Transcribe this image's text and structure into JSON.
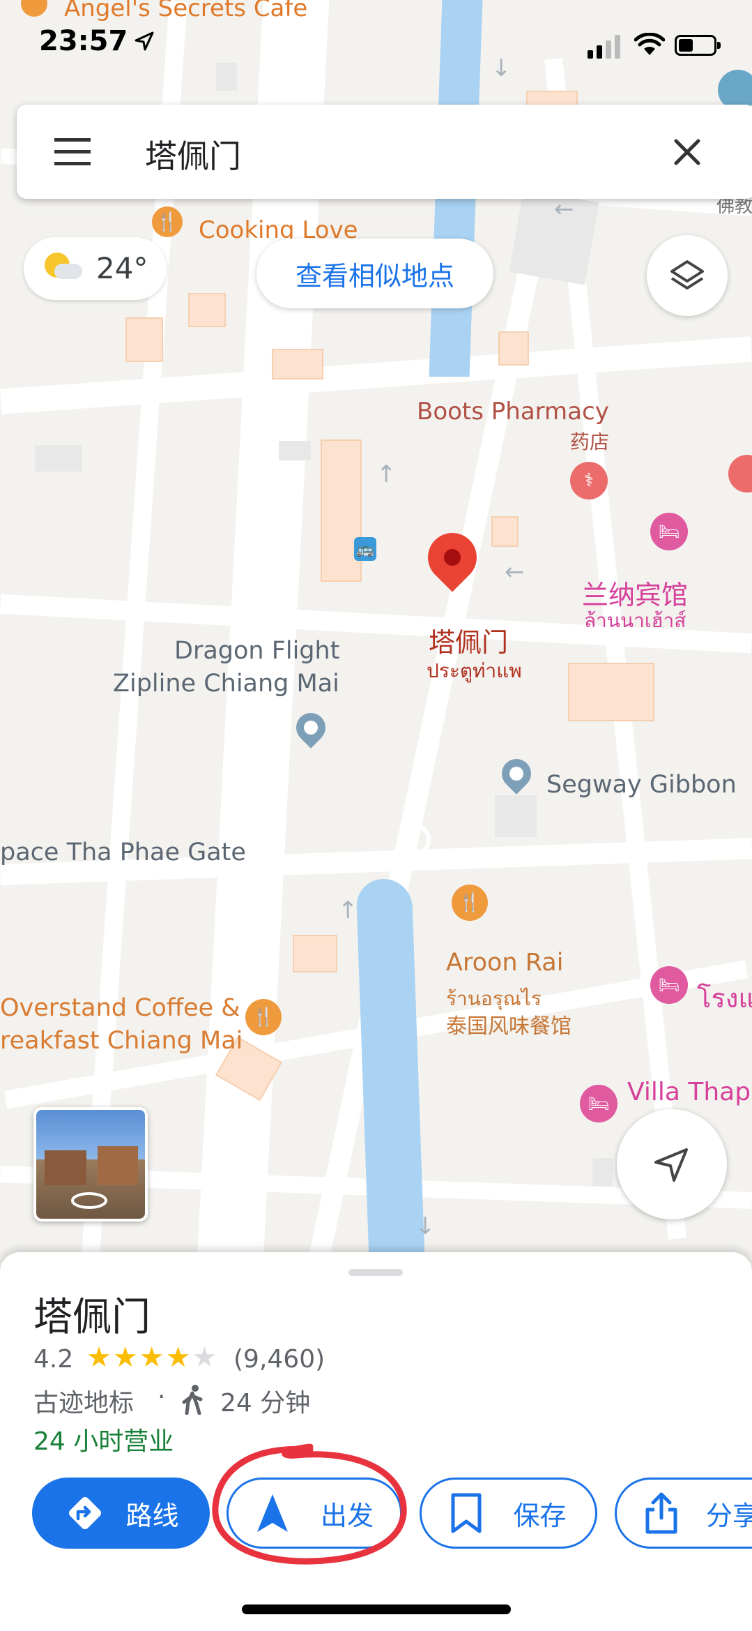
{
  "status": {
    "time": "23:57"
  },
  "search": {
    "query": "塔佩门"
  },
  "weather": {
    "temperature": "24°"
  },
  "similar_places_button": "查看相似地点",
  "map_labels": {
    "angels_cafe": "Angel's Secrets Cafe",
    "cooking_love": "Cooking Love",
    "boots_pharmacy": "Boots Pharmacy",
    "boots_pharmacy_sub": "药店",
    "lanna_hotel": "兰纳宾馆",
    "lanna_hotel_thai": "ล้านนาเฮ้าส์",
    "tha_phae_pin_name": "塔佩门",
    "tha_phae_pin_thai": "ประตูท่าแพ",
    "dragon_flight_1": "Dragon Flight",
    "dragon_flight_2": "Zipline Chiang Mai",
    "segway_gibbon": "Segway Gibbon",
    "space_tha_phae": "pace Tha Phae Gate",
    "aroon_rai": "Aroon Rai",
    "aroon_rai_thai": "ร้านอรุณไร",
    "aroon_rai_sub": "泰国风味餐馆",
    "overstand_1": "Overstand Coffee &",
    "overstand_2": "reakfast Chiang Mai",
    "villa_thapa": "Villa Thapa",
    "rong_hotel": "โรงแ",
    "temple_edge": "佛教"
  },
  "place": {
    "name": "塔佩门",
    "rating": "4.2",
    "stars": 4.2,
    "reviews": "(9,460)",
    "category": "古迹地标",
    "separator": "·",
    "walk_time": "24 分钟",
    "hours": "24 小时营业"
  },
  "actions": {
    "directions": "路线",
    "start": "出发",
    "save": "保存",
    "share": "分享"
  },
  "colors": {
    "accent": "#1a73e8",
    "open_green": "#188038",
    "pin_red": "#ea4335",
    "annotation_red": "#e8333f"
  }
}
